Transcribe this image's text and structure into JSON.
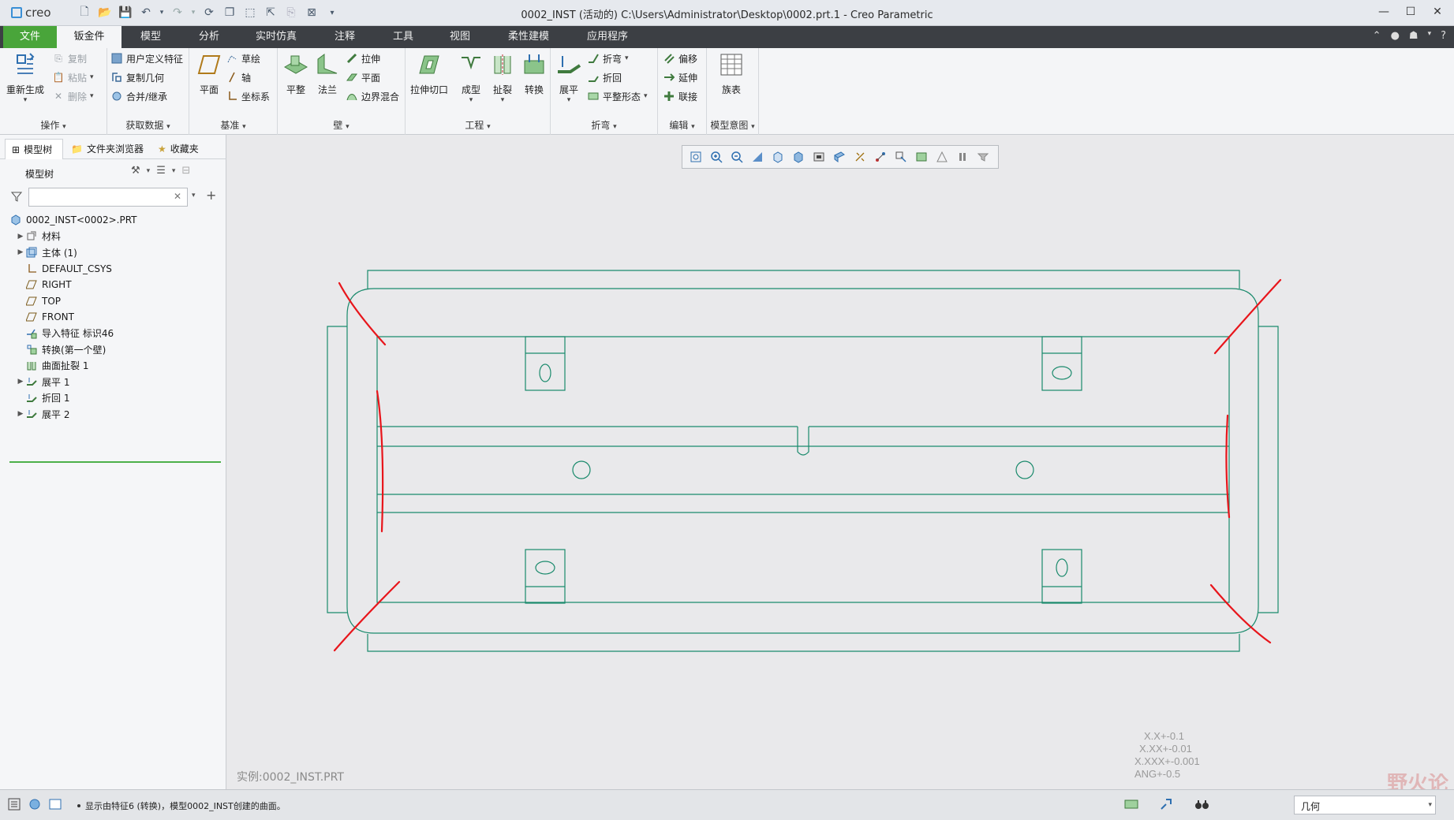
{
  "app": {
    "logo_text": "creo",
    "title": "0002_INST (活动的) C:\\Users\\Administrator\\Desktop\\0002.prt.1 - Creo Parametric"
  },
  "tabs": [
    "文件",
    "钣金件",
    "模型",
    "分析",
    "实时仿真",
    "注释",
    "工具",
    "视图",
    "柔性建模",
    "应用程序"
  ],
  "ribbon": {
    "ops": {
      "regen": "重新生成",
      "copy": "复制",
      "paste": "粘贴",
      "delete": "删除",
      "label": "操作"
    },
    "getdata": {
      "udf": "用户定义特征",
      "copygeom": "复制几何",
      "merge": "合并/继承",
      "label": "获取数据"
    },
    "datum": {
      "plane": "平面",
      "sketch": "草绘",
      "axis": "轴",
      "csys": "坐标系",
      "label": "基准"
    },
    "wall": {
      "flat": "平整",
      "flange": "法兰",
      "extrude": "拉伸",
      "planar": "平面",
      "blend": "边界混合",
      "label": "壁"
    },
    "eng": {
      "extcut": "拉伸切口",
      "form": "成型",
      "rip": "扯裂",
      "convert": "转换",
      "label": "工程"
    },
    "bend": {
      "unbend": "展平",
      "bend": "折弯",
      "bendback": "折回",
      "flatform": "平整形态",
      "label": "折弯"
    },
    "edit": {
      "offset": "偏移",
      "extend": "延伸",
      "join": "联接",
      "label": "编辑"
    },
    "intent": {
      "family": "族表",
      "label": "模型意图"
    }
  },
  "panel": {
    "tabs": [
      "模型树",
      "文件夹浏览器",
      "收藏夹"
    ],
    "tree_label": "模型树",
    "filter_placeholder": "",
    "items": [
      {
        "label": "0002_INST<0002>.PRT"
      },
      {
        "label": "材料"
      },
      {
        "label": "主体 (1)"
      },
      {
        "label": "DEFAULT_CSYS"
      },
      {
        "label": "RIGHT"
      },
      {
        "label": "TOP"
      },
      {
        "label": "FRONT"
      },
      {
        "label": "导入特征 标识46"
      },
      {
        "label": "转换(第一个壁)"
      },
      {
        "label": "曲面扯裂 1"
      },
      {
        "label": "展平 1"
      },
      {
        "label": "折回 1"
      },
      {
        "label": "展平 2"
      }
    ]
  },
  "graphics": {
    "instance_label": "实例:0002_INST.PRT",
    "tolerances": [
      "X.X+-0.1",
      "X.XX+-0.01",
      "X.XXX+-0.001",
      "ANG+-0.5"
    ],
    "watermark": "野火论坛"
  },
  "status": {
    "message": "显示由特征6 (转换)，模型0002_INST创建的曲面。",
    "selection_filter": "几何"
  },
  "colors": {
    "file_tab": "#49a53a",
    "drawing_line": "#1a8a6c",
    "markup": "#e8151b"
  }
}
